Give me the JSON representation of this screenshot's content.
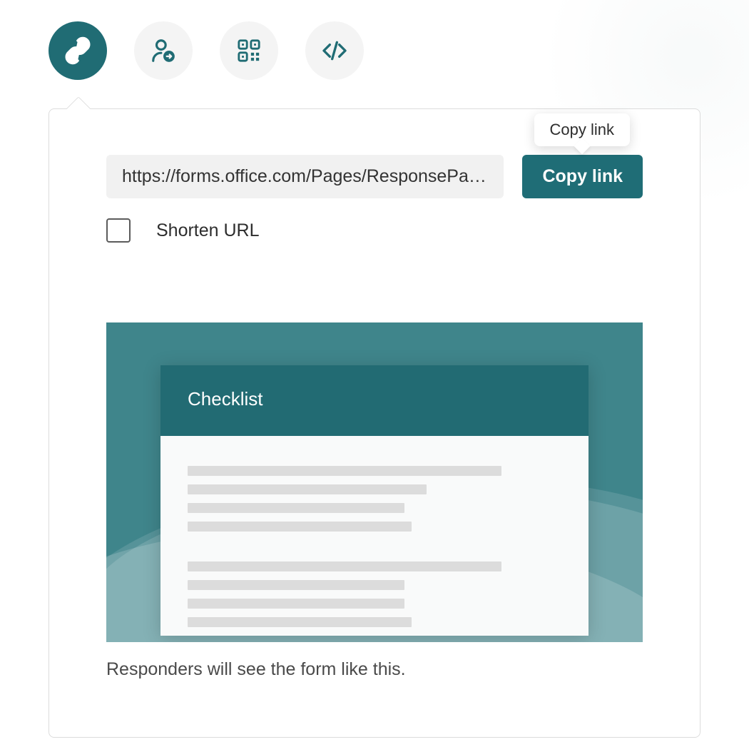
{
  "tabs": {
    "link": "link-icon",
    "invite": "person-share-icon",
    "qr": "qr-code-icon",
    "embed": "code-embed-icon"
  },
  "share": {
    "url": "https://forms.office.com/Pages/ResponsePag…",
    "copy_button": "Copy link",
    "tooltip": "Copy link",
    "shorten_label": "Shorten URL"
  },
  "preview": {
    "form_title": "Checklist",
    "caption": "Responders will see the form like this."
  },
  "colors": {
    "accent": "#206c74"
  }
}
